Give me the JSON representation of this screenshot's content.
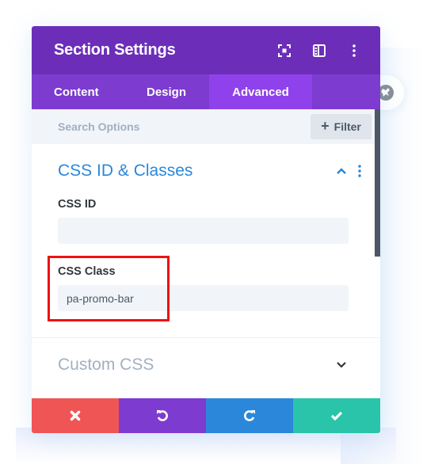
{
  "header": {
    "title": "Section Settings",
    "icons": [
      "expand-icon",
      "sidebar-toggle-icon",
      "more-options-icon"
    ]
  },
  "tabs": [
    {
      "label": "Content",
      "active": false
    },
    {
      "label": "Design",
      "active": false
    },
    {
      "label": "Advanced",
      "active": true
    }
  ],
  "search": {
    "placeholder": "Search Options",
    "value": "",
    "filter_label": "Filter"
  },
  "sections": {
    "css_id_classes": {
      "title": "CSS ID & Classes",
      "expanded": true,
      "fields": {
        "css_id": {
          "label": "CSS ID",
          "value": ""
        },
        "css_class": {
          "label": "CSS Class",
          "value": "pa-promo-bar"
        }
      }
    },
    "custom_css": {
      "title": "Custom CSS",
      "expanded": false
    }
  },
  "footer": {
    "buttons": [
      "discard",
      "undo",
      "redo",
      "save"
    ]
  },
  "colors": {
    "header": "#6c2eb9",
    "tabs": "#7d3bcf",
    "active_tab": "#8f42ec",
    "accent": "#2b87da",
    "discard": "#ef5555",
    "undo": "#7e3bd0",
    "redo": "#2b87da",
    "save": "#29c4a9",
    "highlight": "#ee1111"
  }
}
